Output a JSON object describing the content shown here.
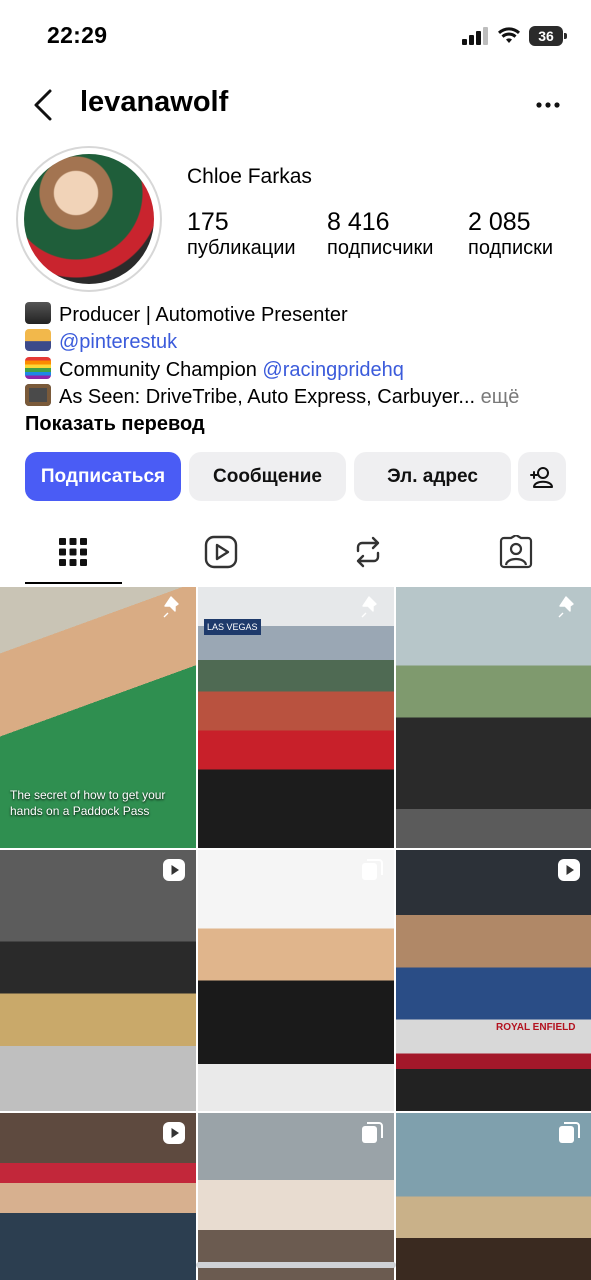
{
  "status_bar": {
    "time": "22:29",
    "battery": "36"
  },
  "header": {
    "username": "levanawolf"
  },
  "profile": {
    "name": "Chloe Farkas",
    "stats": [
      {
        "value": "175",
        "label": "публикации"
      },
      {
        "value": "8 416",
        "label": "подписчики"
      },
      {
        "value": "2 085",
        "label": "подписки"
      }
    ]
  },
  "bio": {
    "line1": "Producer | Automotive Presenter",
    "line2_link": "@pinterestuk",
    "line3_text": "Community Champion ",
    "line3_link": "@racingpridehq",
    "line4_text": "As Seen: DriveTribe, Auto Express, Carbuyer...",
    "line4_more": " ещё",
    "translate": "Показать перевод"
  },
  "buttons": {
    "follow": "Подписаться",
    "message": "Сообщение",
    "email": "Эл. адрес"
  },
  "posts": [
    {
      "caption": "The secret of how to get your hands on a Paddock Pass",
      "badge": "pin-icon"
    },
    {
      "caption": "",
      "badge": "pin-icon"
    },
    {
      "caption": "",
      "badge": "pin-icon"
    },
    {
      "caption": "",
      "badge": "reel-icon"
    },
    {
      "caption": "",
      "badge": "carousel-icon"
    },
    {
      "caption": "",
      "badge": "reel-icon"
    },
    {
      "caption": "",
      "badge": "reel-icon"
    },
    {
      "caption": "",
      "badge": "carousel-icon"
    },
    {
      "caption": "",
      "badge": "carousel-icon"
    }
  ],
  "post_texts": {
    "sign1": "LAS VEGAS",
    "sign2": "ROYAL ENFIELD"
  }
}
